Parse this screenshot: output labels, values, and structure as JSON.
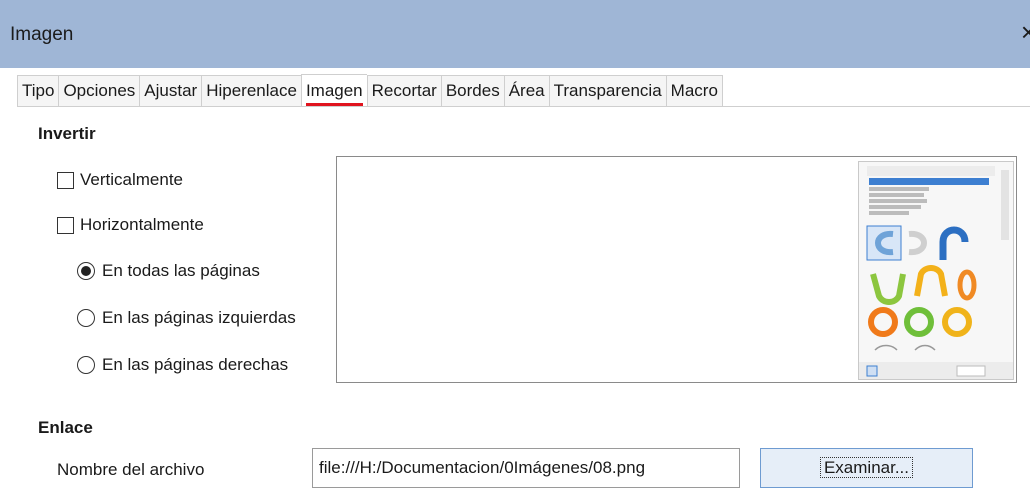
{
  "window": {
    "title": "Imagen",
    "close_icon": "×"
  },
  "tabs": [
    "Tipo",
    "Opciones",
    "Ajustar",
    "Hiperenlace",
    "Imagen",
    "Recortar",
    "Bordes",
    "Área",
    "Transparencia",
    "Macro"
  ],
  "active_tab": "Imagen",
  "invert": {
    "heading": "Invertir",
    "vertical": {
      "label": "Verticalmente",
      "checked": false
    },
    "horizontal": {
      "label": "Horizontalmente",
      "checked": false
    },
    "options": [
      {
        "label": "En todas las páginas",
        "selected": true
      },
      {
        "label": "En las páginas izquierdas",
        "selected": false
      },
      {
        "label": "En las páginas derechas",
        "selected": false
      }
    ]
  },
  "link": {
    "heading": "Enlace",
    "file_label": "Nombre del archivo",
    "file_value": "file:///H:/Documentacion/0Imágenes/08.png",
    "browse_label": "Examinar..."
  },
  "colors": {
    "title_bar": "#9fb6d6",
    "active_tab_marker": "#e0141e",
    "button_border": "#6e9bd1"
  }
}
